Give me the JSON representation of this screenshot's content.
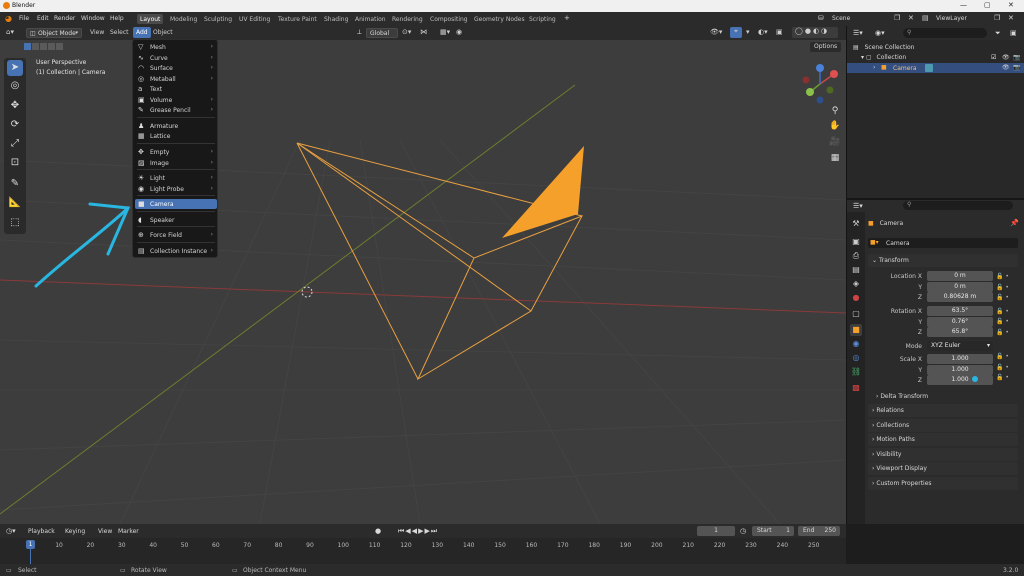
{
  "window": {
    "title": "Blender"
  },
  "menubar": {
    "items": [
      "File",
      "Edit",
      "Render",
      "Window",
      "Help"
    ],
    "workspaces": [
      "Layout",
      "Modeling",
      "Sculpting",
      "UV Editing",
      "Texture Paint",
      "Shading",
      "Animation",
      "Rendering",
      "Compositing",
      "Geometry Nodes",
      "Scripting"
    ],
    "scene": "Scene",
    "view_layer": "ViewLayer"
  },
  "header": {
    "mode": "Object Mode",
    "menus": [
      "View",
      "Select",
      "Add",
      "Object"
    ],
    "orientation": "Global",
    "options": "Options"
  },
  "viewport": {
    "perspective": "User Perspective",
    "context": "(1) Collection | Camera"
  },
  "add_menu": {
    "items": [
      {
        "icon": "▽",
        "label": "Mesh",
        "arrow": "›"
      },
      {
        "icon": "∿",
        "label": "Curve",
        "arrow": "›"
      },
      {
        "icon": "◠",
        "label": "Surface",
        "arrow": "›"
      },
      {
        "icon": "◎",
        "label": "Metaball",
        "arrow": "›"
      },
      {
        "icon": "a",
        "label": "Text",
        "arrow": ""
      },
      {
        "icon": "▣",
        "label": "Volume",
        "arrow": "›"
      },
      {
        "icon": "✎",
        "label": "Grease Pencil",
        "arrow": "›"
      },
      {
        "icon": "♟",
        "label": "Armature",
        "arrow": ""
      },
      {
        "icon": "▦",
        "label": "Lattice",
        "arrow": ""
      },
      {
        "icon": "✥",
        "label": "Empty",
        "arrow": "›"
      },
      {
        "icon": "▨",
        "label": "Image",
        "arrow": "›"
      },
      {
        "icon": "☀",
        "label": "Light",
        "arrow": "›"
      },
      {
        "icon": "◉",
        "label": "Light Probe",
        "arrow": "›"
      },
      {
        "icon": "■",
        "label": "Camera",
        "arrow": ""
      },
      {
        "icon": "◖",
        "label": "Speaker",
        "arrow": ""
      },
      {
        "icon": "⊕",
        "label": "Force Field",
        "arrow": "›"
      },
      {
        "icon": "▤",
        "label": "Collection Instance",
        "arrow": "›"
      }
    ]
  },
  "outliner": {
    "scene_collection": "Scene Collection",
    "collection": "Collection",
    "camera": "Camera"
  },
  "properties": {
    "object_name": "Camera",
    "data_name": "Camera",
    "transform_title": "Transform",
    "location_label": "Location X",
    "loc_x": "0 m",
    "loc_y": "0 m",
    "loc_z": "0.80628 m",
    "rotation_label": "Rotation X",
    "rot_x": "63.5°",
    "rot_y": "0.76°",
    "rot_z": "65.8°",
    "mode_label": "Mode",
    "mode_value": "XYZ Euler",
    "scale_label": "Scale X",
    "scale_x": "1.000",
    "scale_y": "1.000",
    "scale_z": "1.000",
    "axis_y": "Y",
    "axis_z": "Z",
    "delta_transform": "Delta Transform",
    "sections": [
      "Relations",
      "Collections",
      "Motion Paths",
      "Visibility",
      "Viewport Display",
      "Custom Properties"
    ]
  },
  "timeline": {
    "menus": [
      "Playback",
      "Keying",
      "View",
      "Marker"
    ],
    "current_frame": "1",
    "start_label": "Start",
    "start": "1",
    "end_label": "End",
    "end": "250",
    "ticks": [
      "1",
      "10",
      "20",
      "30",
      "40",
      "50",
      "60",
      "70",
      "80",
      "90",
      "100",
      "110",
      "120",
      "130",
      "140",
      "150",
      "160",
      "170",
      "180",
      "190",
      "200",
      "210",
      "220",
      "230",
      "240",
      "250"
    ]
  },
  "statusbar": {
    "select": "Select",
    "rotate": "Rotate View",
    "context_menu": "Object Context Menu",
    "version": "3.2.0"
  },
  "colors": {
    "accent": "#4772b3",
    "camera_orange": "#f5a02a",
    "annotation_arrow": "#29b6e0"
  }
}
